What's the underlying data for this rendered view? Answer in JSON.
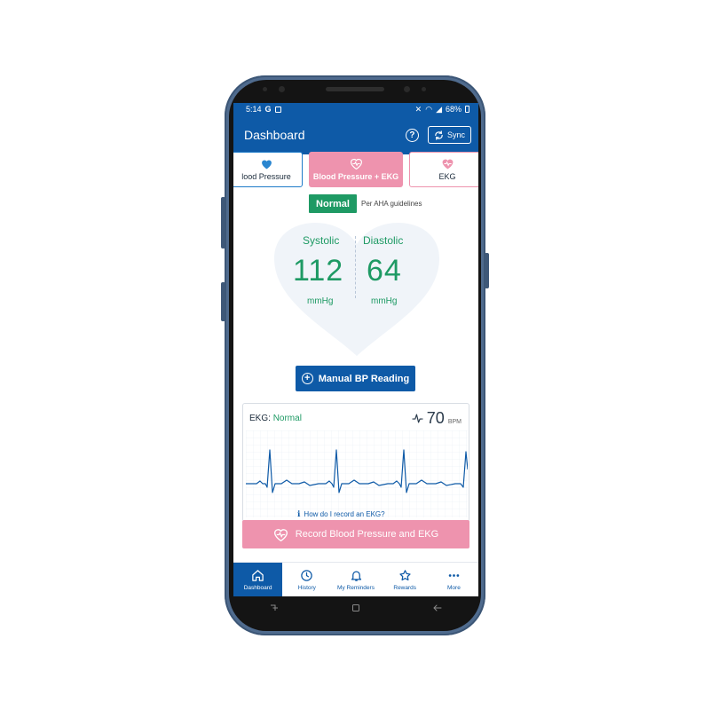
{
  "statusbar": {
    "time": "5:14",
    "g": "G",
    "battery": "68%"
  },
  "appbar": {
    "title": "Dashboard",
    "help": "?",
    "sync_label": "Sync"
  },
  "tabs": [
    {
      "label": "lood Pressure",
      "icon": "heart-icon"
    },
    {
      "label": "Blood Pressure + EKG",
      "icon": "heart-pulse-icon"
    },
    {
      "label": "EKG",
      "icon": "heart-pulse-icon"
    }
  ],
  "reading": {
    "status": "Normal",
    "guideline": "Per AHA guidelines",
    "systolic": {
      "label": "Systolic",
      "value": "112",
      "unit": "mmHg"
    },
    "diastolic": {
      "label": "Diastolic",
      "value": "64",
      "unit": "mmHg"
    }
  },
  "manual_button": {
    "label": "Manual BP Reading"
  },
  "ekg": {
    "label": "EKG:",
    "status": "Normal",
    "bpm": "70",
    "bpm_unit": "BPM"
  },
  "help_link": "How do I record an EKG?",
  "record_button": {
    "label": "Record Blood Pressure and EKG"
  },
  "nav": [
    {
      "label": "Dashboard",
      "icon": "home-icon",
      "active": true
    },
    {
      "label": "History",
      "icon": "clock-icon"
    },
    {
      "label": "My Reminders",
      "icon": "bell-icon"
    },
    {
      "label": "Rewards",
      "icon": "star-icon"
    },
    {
      "label": "More",
      "icon": "more-icon"
    }
  ],
  "colors": {
    "primary": "#0e5aa7",
    "pink": "#ee93ae",
    "green": "#1e9a64"
  }
}
